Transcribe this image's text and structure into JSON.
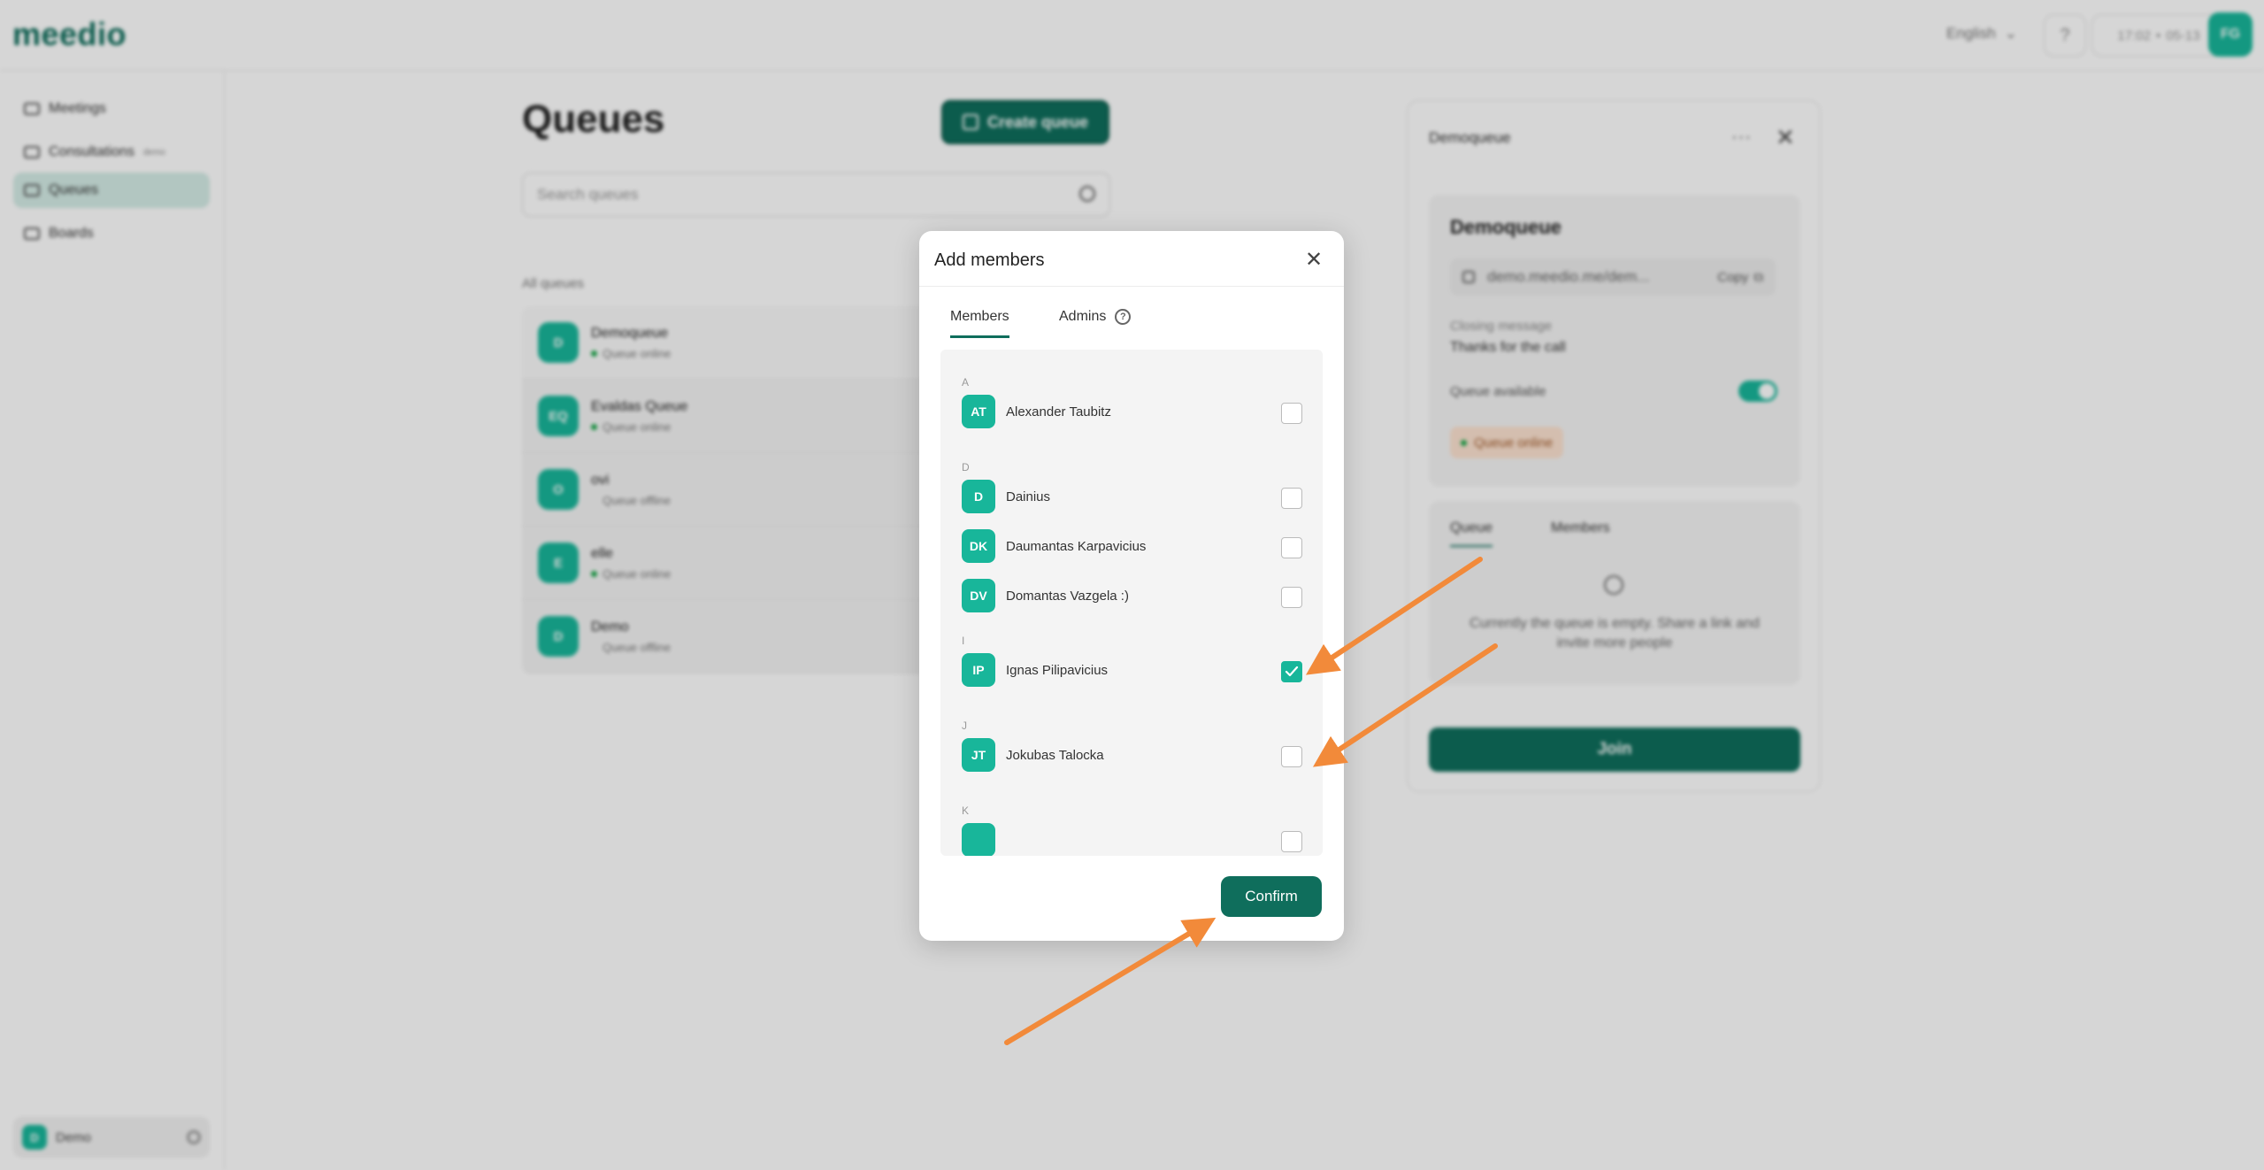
{
  "app": {
    "logo": "meedio",
    "language": "English",
    "help_glyph": "?",
    "time": "17:02",
    "time_separator": "•",
    "date": "05-13",
    "user_initials": "FG"
  },
  "sidebar": {
    "items": [
      {
        "label": "Meetings",
        "icon": "camera-icon"
      },
      {
        "label": "Consultations",
        "badge": "demo",
        "icon": "consult-icon"
      },
      {
        "label": "Queues",
        "icon": "queues-icon"
      },
      {
        "label": "Boards",
        "icon": "boards-icon"
      }
    ],
    "footer": {
      "initial": "D",
      "label": "Demo"
    }
  },
  "main": {
    "title": "Queues",
    "create_label": "Create queue",
    "search_placeholder": "Search queues",
    "all_label": "All queues",
    "queues": [
      {
        "initials": "D",
        "name": "Demoqueue",
        "status": "Queue online",
        "online": true
      },
      {
        "initials": "EQ",
        "name": "Evaldas Queue",
        "status": "Queue online",
        "online": true
      },
      {
        "initials": "O",
        "name": "ovi",
        "status": "Queue offline",
        "online": false
      },
      {
        "initials": "E",
        "name": "elle",
        "status": "Queue online",
        "online": true
      },
      {
        "initials": "D",
        "name": "Demo",
        "status": "Queue offline",
        "online": false
      }
    ]
  },
  "detail": {
    "header": "Demoqueue",
    "more": "···",
    "close": "✕",
    "title": "Demoqueue",
    "link": "demo.meedio.me/dem...",
    "copy_label": "Copy",
    "closing_label": "Closing message",
    "closing_value": "Thanks for the call",
    "available_label": "Queue available",
    "status_pill": "Queue online",
    "tab_queue": "Queue",
    "tab_members": "Members",
    "empty_text": "Currently the queue is empty. Share a link and invite more people",
    "join_label": "Join"
  },
  "modal": {
    "title": "Add members",
    "close": "✕",
    "tab_members": "Members",
    "tab_admins": "Admins",
    "qmark": "?",
    "groups": [
      {
        "letter": "A",
        "members": [
          {
            "initials": "AT",
            "name": "Alexander Taubitz",
            "checked": false
          }
        ]
      },
      {
        "letter": "D",
        "members": [
          {
            "initials": "D",
            "name": "Dainius",
            "checked": false
          },
          {
            "initials": "DK",
            "name": "Daumantas Karpavicius",
            "checked": false
          },
          {
            "initials": "DV",
            "name": "Domantas Vazgela :)",
            "checked": false
          }
        ]
      },
      {
        "letter": "I",
        "members": [
          {
            "initials": "IP",
            "name": "Ignas Pilipavicius",
            "checked": true
          }
        ]
      },
      {
        "letter": "J",
        "members": [
          {
            "initials": "JT",
            "name": "Jokubas Talocka",
            "checked": false
          }
        ]
      },
      {
        "letter": "K",
        "members": []
      }
    ],
    "confirm_label": "Confirm"
  },
  "colors": {
    "brand": "#0f6e5c",
    "accent": "#18b69a",
    "annotation_arrow": "#f28a3a"
  }
}
